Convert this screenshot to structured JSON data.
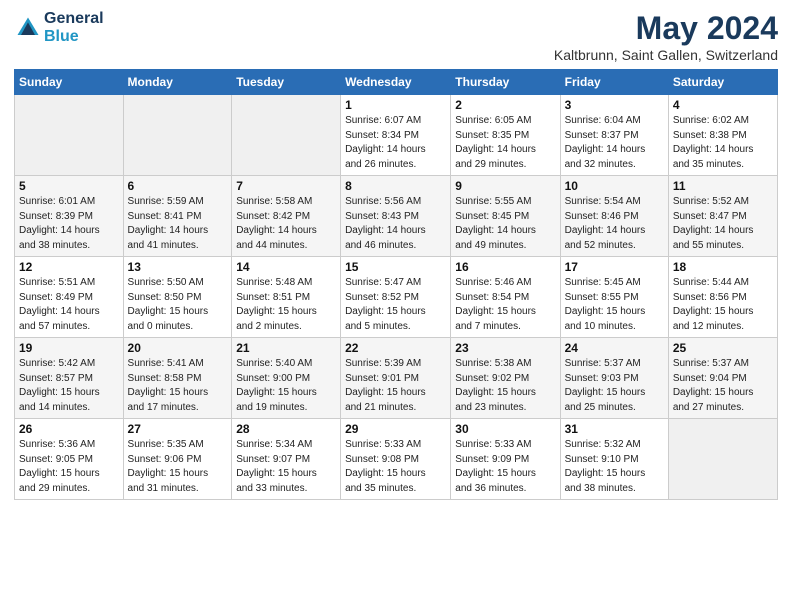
{
  "header": {
    "logo_line1": "General",
    "logo_line2": "Blue",
    "title": "May 2024",
    "subtitle": "Kaltbrunn, Saint Gallen, Switzerland"
  },
  "days_of_week": [
    "Sunday",
    "Monday",
    "Tuesday",
    "Wednesday",
    "Thursday",
    "Friday",
    "Saturday"
  ],
  "weeks": [
    [
      {
        "num": "",
        "info": ""
      },
      {
        "num": "",
        "info": ""
      },
      {
        "num": "",
        "info": ""
      },
      {
        "num": "1",
        "info": "Sunrise: 6:07 AM\nSunset: 8:34 PM\nDaylight: 14 hours\nand 26 minutes."
      },
      {
        "num": "2",
        "info": "Sunrise: 6:05 AM\nSunset: 8:35 PM\nDaylight: 14 hours\nand 29 minutes."
      },
      {
        "num": "3",
        "info": "Sunrise: 6:04 AM\nSunset: 8:37 PM\nDaylight: 14 hours\nand 32 minutes."
      },
      {
        "num": "4",
        "info": "Sunrise: 6:02 AM\nSunset: 8:38 PM\nDaylight: 14 hours\nand 35 minutes."
      }
    ],
    [
      {
        "num": "5",
        "info": "Sunrise: 6:01 AM\nSunset: 8:39 PM\nDaylight: 14 hours\nand 38 minutes."
      },
      {
        "num": "6",
        "info": "Sunrise: 5:59 AM\nSunset: 8:41 PM\nDaylight: 14 hours\nand 41 minutes."
      },
      {
        "num": "7",
        "info": "Sunrise: 5:58 AM\nSunset: 8:42 PM\nDaylight: 14 hours\nand 44 minutes."
      },
      {
        "num": "8",
        "info": "Sunrise: 5:56 AM\nSunset: 8:43 PM\nDaylight: 14 hours\nand 46 minutes."
      },
      {
        "num": "9",
        "info": "Sunrise: 5:55 AM\nSunset: 8:45 PM\nDaylight: 14 hours\nand 49 minutes."
      },
      {
        "num": "10",
        "info": "Sunrise: 5:54 AM\nSunset: 8:46 PM\nDaylight: 14 hours\nand 52 minutes."
      },
      {
        "num": "11",
        "info": "Sunrise: 5:52 AM\nSunset: 8:47 PM\nDaylight: 14 hours\nand 55 minutes."
      }
    ],
    [
      {
        "num": "12",
        "info": "Sunrise: 5:51 AM\nSunset: 8:49 PM\nDaylight: 14 hours\nand 57 minutes."
      },
      {
        "num": "13",
        "info": "Sunrise: 5:50 AM\nSunset: 8:50 PM\nDaylight: 15 hours\nand 0 minutes."
      },
      {
        "num": "14",
        "info": "Sunrise: 5:48 AM\nSunset: 8:51 PM\nDaylight: 15 hours\nand 2 minutes."
      },
      {
        "num": "15",
        "info": "Sunrise: 5:47 AM\nSunset: 8:52 PM\nDaylight: 15 hours\nand 5 minutes."
      },
      {
        "num": "16",
        "info": "Sunrise: 5:46 AM\nSunset: 8:54 PM\nDaylight: 15 hours\nand 7 minutes."
      },
      {
        "num": "17",
        "info": "Sunrise: 5:45 AM\nSunset: 8:55 PM\nDaylight: 15 hours\nand 10 minutes."
      },
      {
        "num": "18",
        "info": "Sunrise: 5:44 AM\nSunset: 8:56 PM\nDaylight: 15 hours\nand 12 minutes."
      }
    ],
    [
      {
        "num": "19",
        "info": "Sunrise: 5:42 AM\nSunset: 8:57 PM\nDaylight: 15 hours\nand 14 minutes."
      },
      {
        "num": "20",
        "info": "Sunrise: 5:41 AM\nSunset: 8:58 PM\nDaylight: 15 hours\nand 17 minutes."
      },
      {
        "num": "21",
        "info": "Sunrise: 5:40 AM\nSunset: 9:00 PM\nDaylight: 15 hours\nand 19 minutes."
      },
      {
        "num": "22",
        "info": "Sunrise: 5:39 AM\nSunset: 9:01 PM\nDaylight: 15 hours\nand 21 minutes."
      },
      {
        "num": "23",
        "info": "Sunrise: 5:38 AM\nSunset: 9:02 PM\nDaylight: 15 hours\nand 23 minutes."
      },
      {
        "num": "24",
        "info": "Sunrise: 5:37 AM\nSunset: 9:03 PM\nDaylight: 15 hours\nand 25 minutes."
      },
      {
        "num": "25",
        "info": "Sunrise: 5:37 AM\nSunset: 9:04 PM\nDaylight: 15 hours\nand 27 minutes."
      }
    ],
    [
      {
        "num": "26",
        "info": "Sunrise: 5:36 AM\nSunset: 9:05 PM\nDaylight: 15 hours\nand 29 minutes."
      },
      {
        "num": "27",
        "info": "Sunrise: 5:35 AM\nSunset: 9:06 PM\nDaylight: 15 hours\nand 31 minutes."
      },
      {
        "num": "28",
        "info": "Sunrise: 5:34 AM\nSunset: 9:07 PM\nDaylight: 15 hours\nand 33 minutes."
      },
      {
        "num": "29",
        "info": "Sunrise: 5:33 AM\nSunset: 9:08 PM\nDaylight: 15 hours\nand 35 minutes."
      },
      {
        "num": "30",
        "info": "Sunrise: 5:33 AM\nSunset: 9:09 PM\nDaylight: 15 hours\nand 36 minutes."
      },
      {
        "num": "31",
        "info": "Sunrise: 5:32 AM\nSunset: 9:10 PM\nDaylight: 15 hours\nand 38 minutes."
      },
      {
        "num": "",
        "info": ""
      }
    ]
  ]
}
